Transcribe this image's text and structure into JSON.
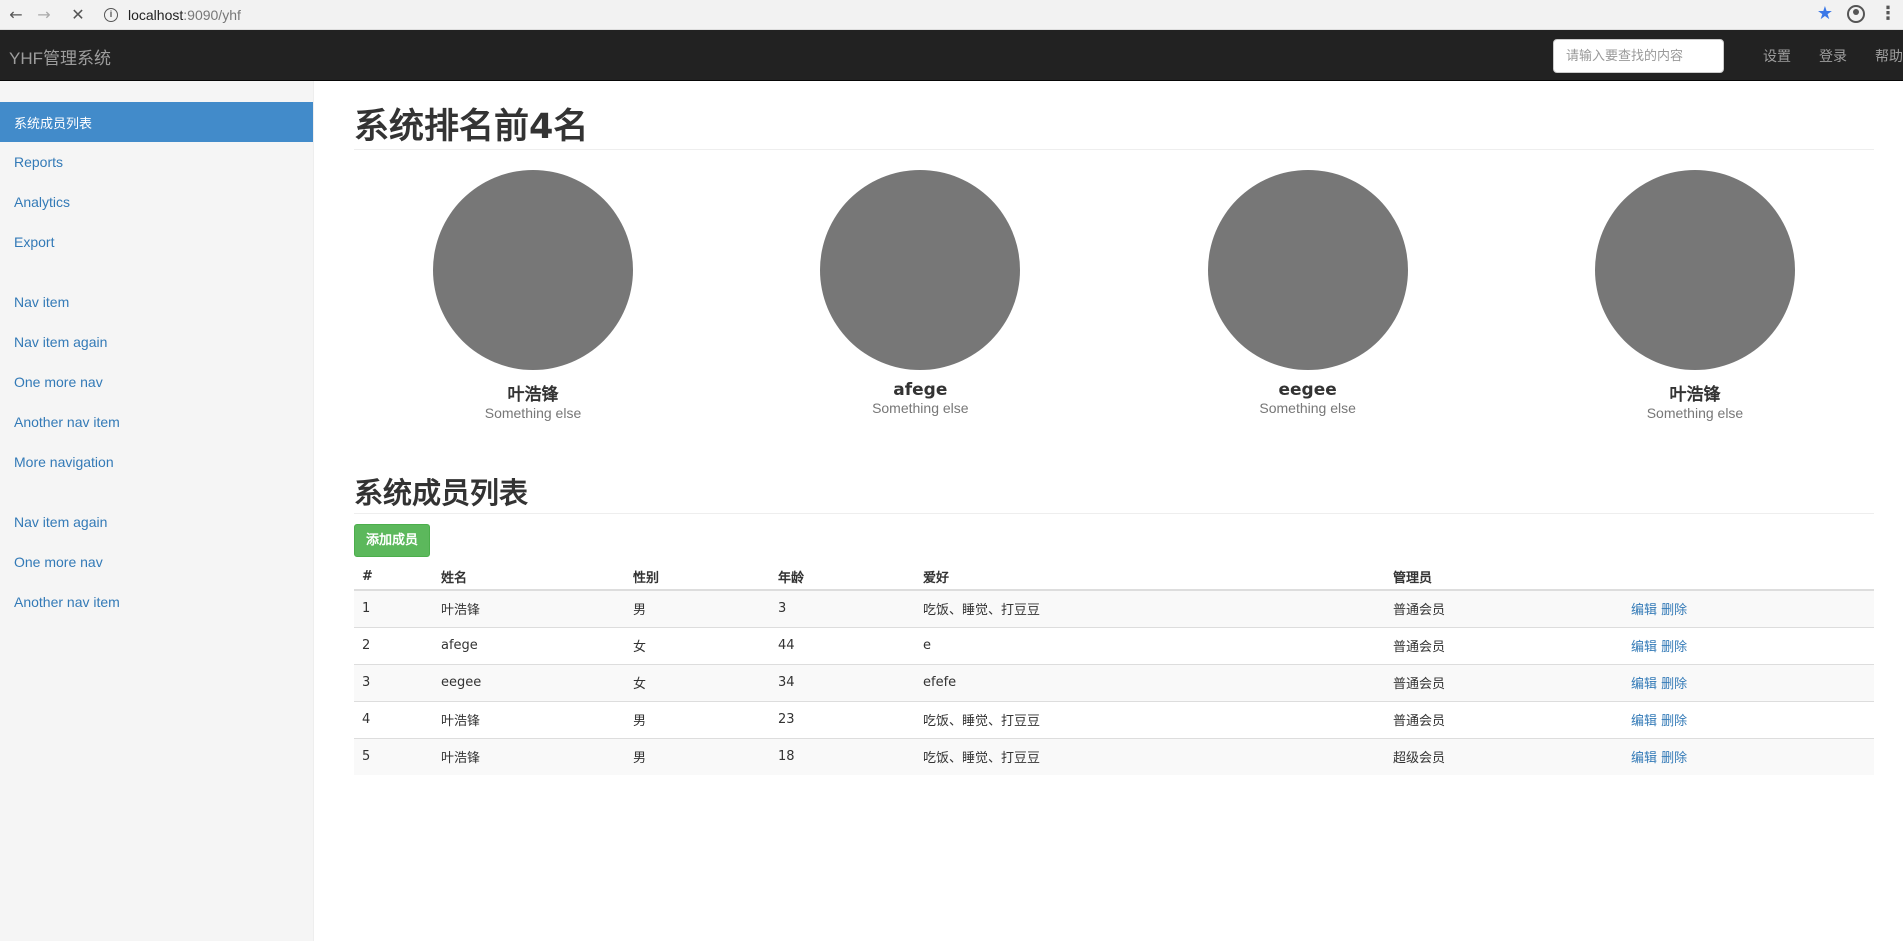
{
  "browser": {
    "url_host": "localhost",
    "url_path": ":9090/yhf"
  },
  "navbar": {
    "brand": "YHF管理系统",
    "search_placeholder": "请输入要查找的内容",
    "links": [
      "设置",
      "登录",
      "帮助"
    ]
  },
  "sidebar": {
    "groups": [
      [
        "系统成员列表",
        "Reports",
        "Analytics",
        "Export"
      ],
      [
        "Nav item",
        "Nav item again",
        "One more nav",
        "Another nav item",
        "More navigation"
      ],
      [
        "Nav item again",
        "One more nav",
        "Another nav item"
      ]
    ]
  },
  "main": {
    "top_title": "系统排名前4名",
    "ranking": [
      {
        "name": "叶浩锋",
        "sub": "Something else"
      },
      {
        "name": "afege",
        "sub": "Something else"
      },
      {
        "name": "eegee",
        "sub": "Something else"
      },
      {
        "name": "叶浩锋",
        "sub": "Something else"
      }
    ],
    "list_title": "系统成员列表",
    "add_button": "添加成员",
    "table": {
      "headers": [
        "#",
        "姓名",
        "性别",
        "年龄",
        "爱好",
        "管理员",
        ""
      ],
      "rows": [
        [
          "1",
          "叶浩锋",
          "男",
          "3",
          "吃饭、睡觉、打豆豆",
          "普通会员"
        ],
        [
          "2",
          "afege",
          "女",
          "44",
          "e",
          "普通会员"
        ],
        [
          "3",
          "eegee",
          "女",
          "34",
          "efefe",
          "普通会员"
        ],
        [
          "4",
          "叶浩锋",
          "男",
          "23",
          "吃饭、睡觉、打豆豆",
          "普通会员"
        ],
        [
          "5",
          "叶浩锋",
          "男",
          "18",
          "吃饭、睡觉、打豆豆",
          "超级会员"
        ]
      ],
      "edit_label": "编辑",
      "delete_label": "删除"
    }
  },
  "colors": {
    "navbar_bg": "#222222",
    "sidebar_active": "#428bca",
    "link": "#337ab7",
    "success_button": "#5cb85c",
    "placeholder_circle": "#777777"
  }
}
